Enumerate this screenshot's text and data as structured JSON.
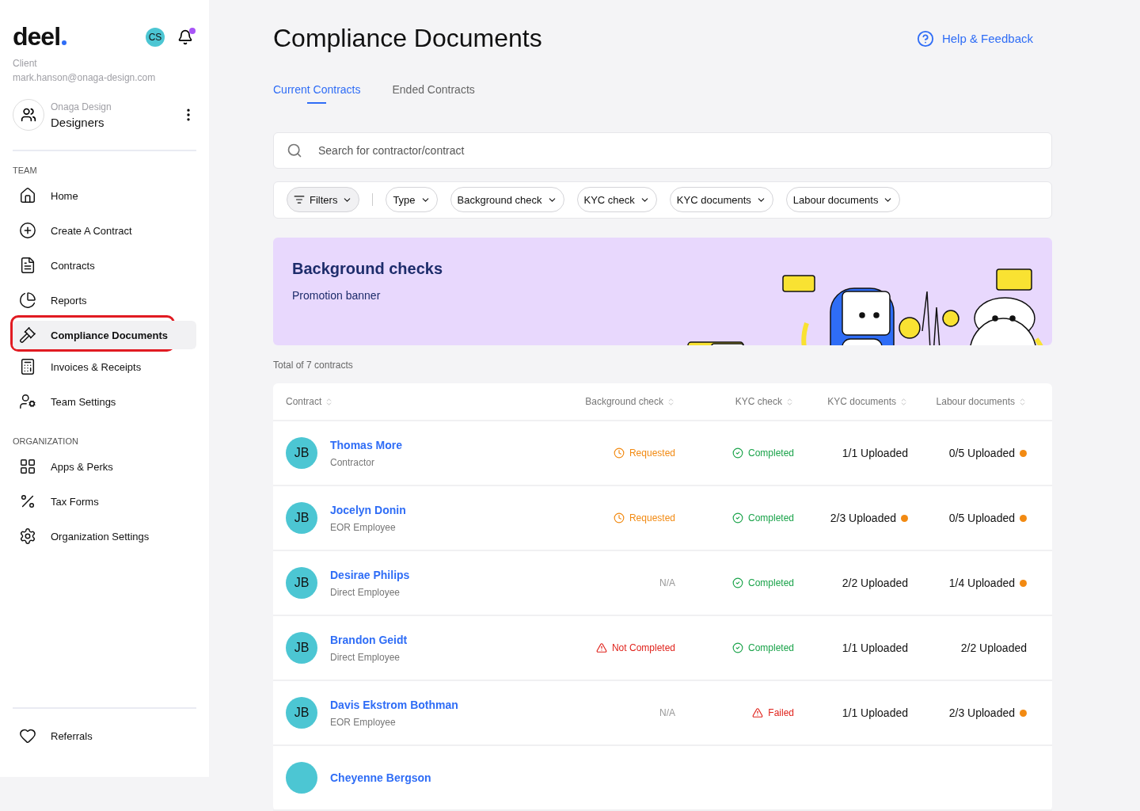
{
  "brand": {
    "logo": "deel",
    "avatar": "CS",
    "notification": true,
    "role": "Client",
    "email": "mark.hanson@onaga-design.com"
  },
  "team": {
    "company": "Onaga Design",
    "name": "Designers"
  },
  "sidebar": {
    "sections": [
      {
        "heading": "TEAM",
        "items": [
          {
            "label": "Home",
            "selected": false
          },
          {
            "label": "Create A Contract",
            "selected": false
          },
          {
            "label": "Contracts",
            "selected": false
          },
          {
            "label": "Reports",
            "selected": false
          },
          {
            "label": "Compliance Documents",
            "selected": true
          },
          {
            "label": "Invoices & Receipts",
            "selected": false
          },
          {
            "label": "Team Settings",
            "selected": false
          }
        ]
      },
      {
        "heading": "ORGANIZATION",
        "items": [
          {
            "label": "Apps & Perks",
            "selected": false
          },
          {
            "label": "Tax Forms",
            "selected": false
          },
          {
            "label": "Organization Settings",
            "selected": false
          }
        ]
      }
    ],
    "footer": {
      "label": "Referrals",
      "selected": false
    }
  },
  "page": {
    "title": "Compliance Documents",
    "help": "Help & Feedback"
  },
  "tabs": [
    {
      "label": "Current Contracts",
      "selected": true
    },
    {
      "label": "Ended Contracts",
      "selected": false
    }
  ],
  "search": {
    "placeholder": "Search for contractor/contract"
  },
  "filters": [
    {
      "label": "Filters",
      "kind": "main"
    },
    {
      "label": "Type",
      "kind": "chip"
    },
    {
      "label": "Background check",
      "kind": "chip"
    },
    {
      "label": "KYC check",
      "kind": "chip"
    },
    {
      "label": "KYC documents",
      "kind": "chip"
    },
    {
      "label": "Labour documents",
      "kind": "chip"
    }
  ],
  "banner": {
    "title": "Background checks",
    "subtitle": "Promotion banner"
  },
  "total": "Total of 7 contracts",
  "table": {
    "columns": [
      "Contract",
      "Background check",
      "KYC check",
      "KYC documents",
      "Labour documents"
    ],
    "rows": [
      {
        "initials": "JB",
        "name": "Thomas More",
        "type": "Contractor",
        "background": {
          "kind": "requested",
          "text": "Requested"
        },
        "kyc": {
          "kind": "completed",
          "text": "Completed"
        },
        "kyc_docs": {
          "text": "1/1 Uploaded",
          "pending": false
        },
        "labour_docs": {
          "text": "0/5 Uploaded",
          "pending": true
        }
      },
      {
        "initials": "JB",
        "name": "Jocelyn Donin",
        "type": "EOR Employee",
        "background": {
          "kind": "requested",
          "text": "Requested"
        },
        "kyc": {
          "kind": "completed",
          "text": "Completed"
        },
        "kyc_docs": {
          "text": "2/3 Uploaded",
          "pending": true
        },
        "labour_docs": {
          "text": "0/5 Uploaded",
          "pending": true
        }
      },
      {
        "initials": "JB",
        "name": "Desirae Philips",
        "type": "Direct Employee",
        "background": {
          "kind": "na",
          "text": "N/A"
        },
        "kyc": {
          "kind": "completed",
          "text": "Completed"
        },
        "kyc_docs": {
          "text": "2/2 Uploaded",
          "pending": false
        },
        "labour_docs": {
          "text": "1/4 Uploaded",
          "pending": true
        }
      },
      {
        "initials": "JB",
        "name": "Brandon Geidt",
        "type": "Direct Employee",
        "background": {
          "kind": "not_completed",
          "text": "Not Completed"
        },
        "kyc": {
          "kind": "completed",
          "text": "Completed"
        },
        "kyc_docs": {
          "text": "1/1 Uploaded",
          "pending": false
        },
        "labour_docs": {
          "text": "2/2 Uploaded",
          "pending": false
        }
      },
      {
        "initials": "JB",
        "name": "Davis Ekstrom Bothman",
        "type": "EOR Employee",
        "background": {
          "kind": "na",
          "text": "N/A"
        },
        "kyc": {
          "kind": "failed",
          "text": "Failed"
        },
        "kyc_docs": {
          "text": "1/1 Uploaded",
          "pending": false
        },
        "labour_docs": {
          "text": "2/3 Uploaded",
          "pending": true
        }
      },
      {
        "name": "Cheyenne Bergson"
      }
    ]
  }
}
